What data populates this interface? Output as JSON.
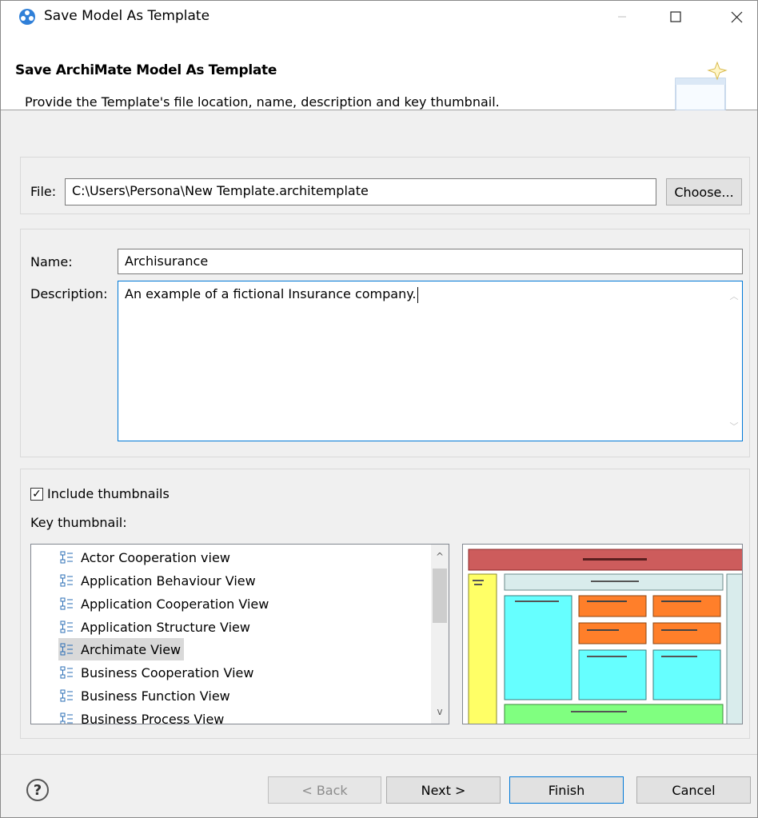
{
  "window": {
    "title": "Save Model As Template",
    "minimize_icon": "minimize-icon",
    "maximize_icon": "maximize-icon",
    "close_icon": "close-icon"
  },
  "banner": {
    "title": "Save ArchiMate Model As Template",
    "description": "Provide the Template's file location, name, description and key thumbnail."
  },
  "file": {
    "label": "File:",
    "value": "C:\\Users\\Persona\\New Template.architemplate",
    "choose_label": "Choose..."
  },
  "details": {
    "name_label": "Name:",
    "name_value": "Archisurance",
    "description_label": "Description:",
    "description_value": "An example of a fictional Insurance company."
  },
  "thumbnails": {
    "include_label": "Include thumbnails",
    "include_checked": true,
    "key_label": "Key thumbnail:",
    "views": [
      "Actor Cooperation view",
      "Application Behaviour View",
      "Application Cooperation View",
      "Application Structure View",
      "Archimate View",
      "Business Cooperation View",
      "Business Function View",
      "Business Process View"
    ],
    "selected_view": "Archimate View"
  },
  "buttons": {
    "back": "< Back",
    "next": "Next >",
    "finish": "Finish",
    "cancel": "Cancel",
    "help": "?"
  },
  "colors": {
    "accent": "#0078d7",
    "selection": "#d9d9d9"
  }
}
